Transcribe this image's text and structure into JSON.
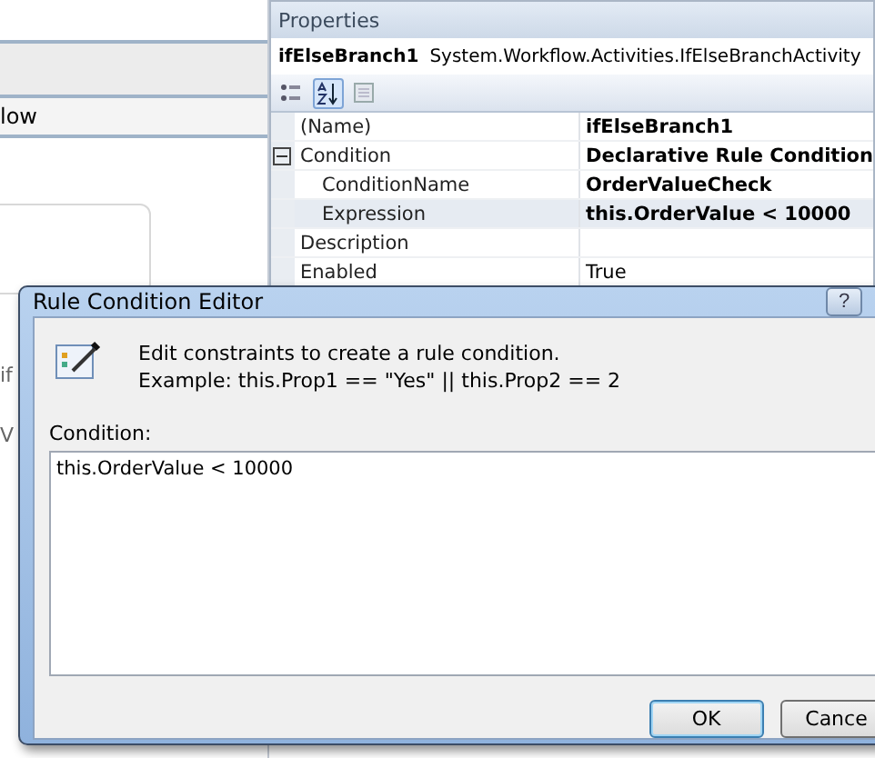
{
  "designer": {
    "tab_text": "low",
    "fragments": [
      "if",
      "V"
    ]
  },
  "properties": {
    "title": "Properties",
    "object_name": "ifElseBranch1",
    "object_type": "System.Workflow.Activities.IfElseBranchActivity",
    "toolbar": [
      {
        "kind": "categorized",
        "selected": false
      },
      {
        "kind": "alphabetical",
        "selected": true
      },
      {
        "kind": "pages",
        "selected": false
      }
    ],
    "rows": [
      {
        "name": "(Name)",
        "value": "ifElseBranch1",
        "bold": true,
        "selected": false
      },
      {
        "name": "Condition",
        "value": "Declarative Rule Condition",
        "bold": true,
        "selected": false,
        "expanded": true,
        "children": [
          {
            "name": "ConditionName",
            "value": "OrderValueCheck",
            "bold": true,
            "selected": false
          },
          {
            "name": "Expression",
            "value": "this.OrderValue < 10000",
            "bold": true,
            "selected": true
          }
        ]
      },
      {
        "name": "Description",
        "value": "",
        "selected": false
      },
      {
        "name": "Enabled",
        "value": "True",
        "bold": false,
        "selected": false
      }
    ]
  },
  "dialog": {
    "title": "Rule Condition Editor",
    "help": "?",
    "instructions": [
      "Edit constraints to create a rule condition.",
      "Example: this.Prop1 == \"Yes\" || this.Prop2 == 2"
    ],
    "condition_label": "Condition:",
    "condition_value": "this.OrderValue < 10000",
    "buttons": [
      {
        "label": "OK",
        "default": true
      },
      {
        "label": "Cance",
        "default": false
      }
    ]
  }
}
